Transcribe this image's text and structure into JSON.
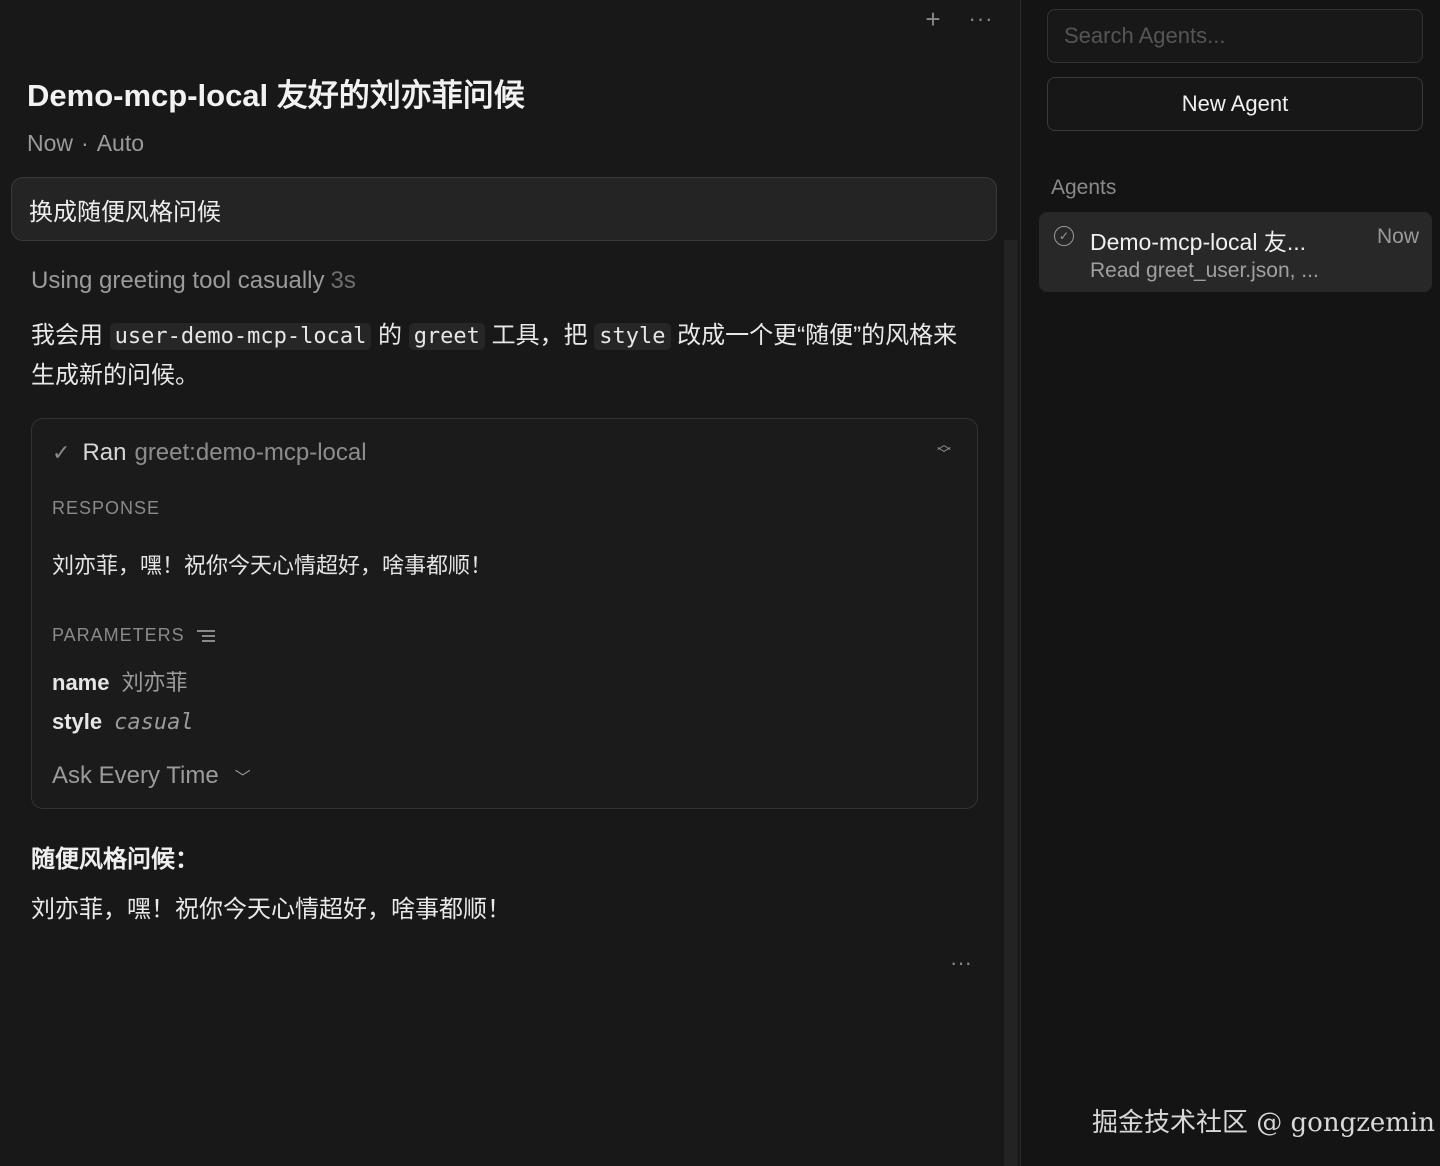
{
  "header": {
    "title": "Demo-mcp-local 友好的刘亦菲问候",
    "meta_time": "Now",
    "meta_separator": "·",
    "meta_mode": "Auto"
  },
  "top_actions": {
    "add_icon": "plus-icon",
    "more_icon": "ellipsis-icon"
  },
  "prompt": {
    "text": "换成随便风格问候"
  },
  "thinking": {
    "label": "Using greeting tool casually",
    "duration": "3s"
  },
  "assistant_intro": {
    "part1": "我会用 ",
    "code1": "user-demo-mcp-local",
    "part2": " 的 ",
    "code2": "greet",
    "part3": " 工具，把 ",
    "code3": "style",
    "part4": " 改成一个更“随便”的风格来生成新的问候。"
  },
  "tool_call": {
    "status": "Ran",
    "tool_name": "greet:demo-mcp-local",
    "response_label": "RESPONSE",
    "response_text": "刘亦菲，嘿！祝你今天心情超好，啥事都顺！",
    "parameters_label": "PARAMETERS",
    "params": [
      {
        "key": "name",
        "value": "刘亦菲"
      },
      {
        "key": "style",
        "value": "casual"
      }
    ],
    "approval_mode": "Ask Every Time"
  },
  "final": {
    "heading": "随便风格问候：",
    "text": "刘亦菲，嘿！祝你今天心情超好，啥事都顺！"
  },
  "sidebar": {
    "search_placeholder": "Search Agents...",
    "new_agent_label": "New Agent",
    "section_label": "Agents",
    "agents": [
      {
        "title": "Demo-mcp-local 友...",
        "time": "Now",
        "subtitle": "Read greet_user.json, ..."
      }
    ]
  },
  "watermark": "掘金技术社区 @ gongzemin",
  "colors": {
    "background": "#181818",
    "sidebar_background": "#141414",
    "card_border": "#333333",
    "muted_text": "#9a9a9a"
  }
}
